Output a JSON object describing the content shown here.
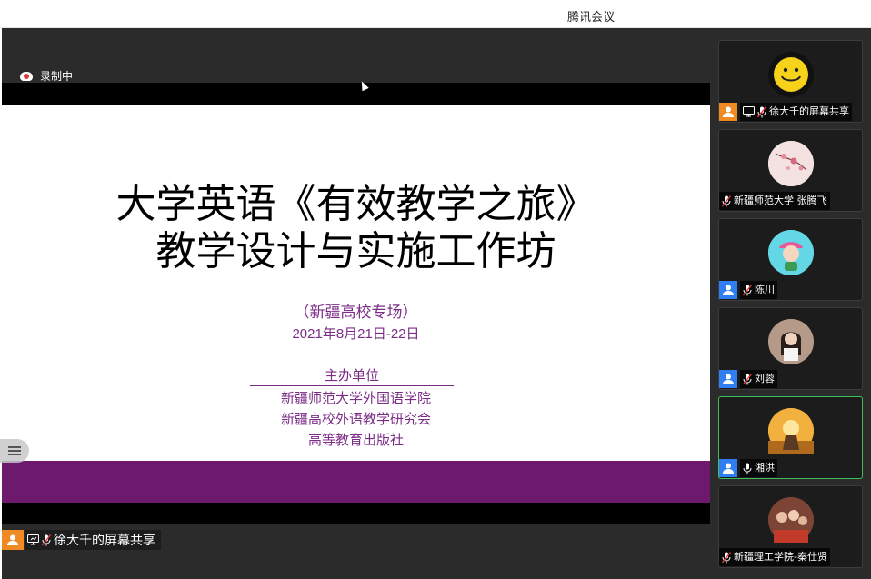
{
  "window": {
    "title": "腾讯会议"
  },
  "recording": {
    "label": "录制中"
  },
  "slide": {
    "title_line1": "大学英语《有效教学之旅》",
    "title_line2": "教学设计与实施工作坊",
    "subtitle": "（新疆高校专场）",
    "date": "2021年8月21日-22日",
    "organizer_heading": "主办单位",
    "organizers": [
      "新疆师范大学外国语学院",
      "新疆高校外语教学研究会",
      "高等教育出版社"
    ]
  },
  "sharer": {
    "label": "徐大千的屏幕共享"
  },
  "participants": [
    {
      "name": "徐大千的屏幕共享",
      "avatar": "smiley-avatar",
      "badge": "orange",
      "sharing": true,
      "muted": true,
      "active": false
    },
    {
      "name": "新疆师范大学 张腾飞",
      "avatar": "blossom-avatar",
      "badge": "none",
      "sharing": false,
      "muted": true,
      "active": false
    },
    {
      "name": "陈川",
      "avatar": "illustration-avatar",
      "badge": "blue",
      "sharing": false,
      "muted": true,
      "active": false
    },
    {
      "name": "刘蓉",
      "avatar": "photo-avatar",
      "badge": "blue",
      "sharing": false,
      "muted": true,
      "active": false
    },
    {
      "name": "湘洪",
      "avatar": "sunset-avatar",
      "badge": "blue",
      "sharing": false,
      "muted": false,
      "active": true
    },
    {
      "name": "新疆理工学院-秦仕贤",
      "avatar": "group-photo-avatar",
      "badge": "none",
      "sharing": false,
      "muted": true,
      "active": false
    }
  ],
  "colors": {
    "accent_purple": "#7b2d86",
    "band_purple": "#6d1a6e",
    "active_border": "#3fbf5a",
    "user_blue": "#2f7ff3",
    "user_orange": "#f08a24"
  }
}
